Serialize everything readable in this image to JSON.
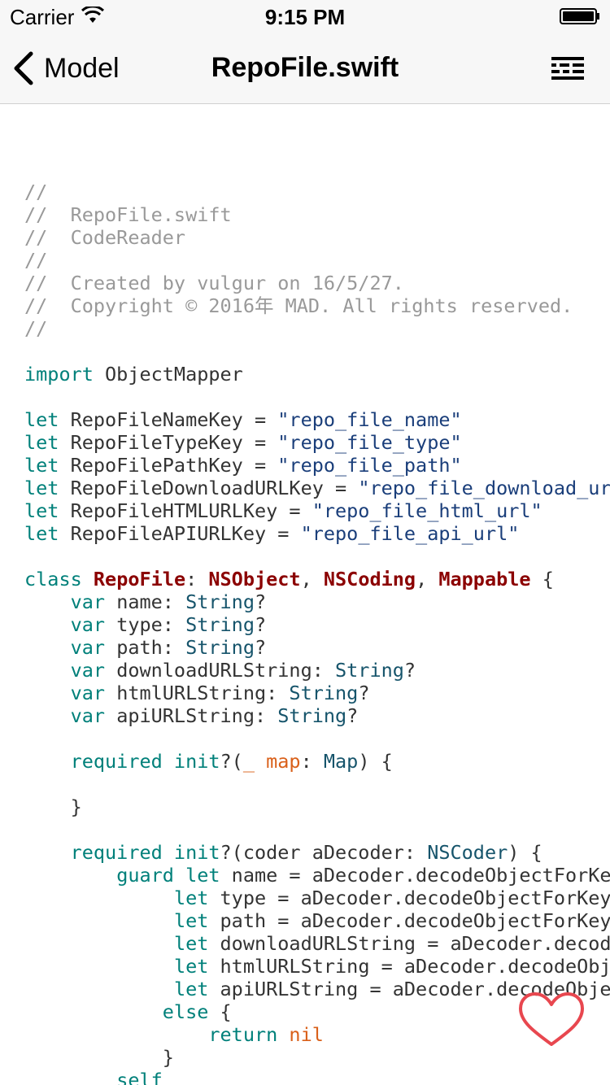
{
  "status_bar": {
    "carrier": "Carrier",
    "time": "9:15 PM"
  },
  "nav": {
    "back_label": "Model",
    "title": "RepoFile.swift"
  },
  "colors": {
    "keyword": "#00807a",
    "comment": "#999999",
    "class_name": "#8b0000",
    "string": "#1a3e7a",
    "param": "#d9601a",
    "heart": "#e8474f"
  },
  "code_lines": [
    [
      {
        "t": "//",
        "k": "comment"
      }
    ],
    [
      {
        "t": "//  RepoFile.swift",
        "k": "comment"
      }
    ],
    [
      {
        "t": "//  CodeReader",
        "k": "comment"
      }
    ],
    [
      {
        "t": "//",
        "k": "comment"
      }
    ],
    [
      {
        "t": "//  Created by vulgur on 16/5/27.",
        "k": "comment"
      }
    ],
    [
      {
        "t": "//  Copyright © 2016年 MAD. All rights reserved.",
        "k": "comment"
      }
    ],
    [
      {
        "t": "//",
        "k": "comment"
      }
    ],
    [],
    [
      {
        "t": "import",
        "k": "kw"
      },
      {
        "t": " ObjectMapper",
        "k": "plain"
      }
    ],
    [],
    [
      {
        "t": "let",
        "k": "kw"
      },
      {
        "t": " RepoFileNameKey = ",
        "k": "plain"
      },
      {
        "t": "\"repo_file_name\"",
        "k": "str"
      }
    ],
    [
      {
        "t": "let",
        "k": "kw"
      },
      {
        "t": " RepoFileTypeKey = ",
        "k": "plain"
      },
      {
        "t": "\"repo_file_type\"",
        "k": "str"
      }
    ],
    [
      {
        "t": "let",
        "k": "kw"
      },
      {
        "t": " RepoFilePathKey = ",
        "k": "plain"
      },
      {
        "t": "\"repo_file_path\"",
        "k": "str"
      }
    ],
    [
      {
        "t": "let",
        "k": "kw"
      },
      {
        "t": " RepoFileDownloadURLKey = ",
        "k": "plain"
      },
      {
        "t": "\"repo_file_download_url\"",
        "k": "str"
      }
    ],
    [
      {
        "t": "let",
        "k": "kw"
      },
      {
        "t": " RepoFileHTMLURLKey = ",
        "k": "plain"
      },
      {
        "t": "\"repo_file_html_url\"",
        "k": "str"
      }
    ],
    [
      {
        "t": "let",
        "k": "kw"
      },
      {
        "t": " RepoFileAPIURLKey = ",
        "k": "plain"
      },
      {
        "t": "\"repo_file_api_url\"",
        "k": "str"
      }
    ],
    [],
    [
      {
        "t": "class",
        "k": "kw"
      },
      {
        "t": " ",
        "k": "plain"
      },
      {
        "t": "RepoFile",
        "k": "cls"
      },
      {
        "t": ": ",
        "k": "plain"
      },
      {
        "t": "NSObject",
        "k": "cls"
      },
      {
        "t": ", ",
        "k": "plain"
      },
      {
        "t": "NSCoding",
        "k": "cls"
      },
      {
        "t": ", ",
        "k": "plain"
      },
      {
        "t": "Mappable",
        "k": "cls"
      },
      {
        "t": " {",
        "k": "plain"
      }
    ],
    [
      {
        "t": "    ",
        "k": "plain"
      },
      {
        "t": "var",
        "k": "kw"
      },
      {
        "t": " name: ",
        "k": "plain"
      },
      {
        "t": "String",
        "k": "type"
      },
      {
        "t": "?",
        "k": "plain"
      }
    ],
    [
      {
        "t": "    ",
        "k": "plain"
      },
      {
        "t": "var",
        "k": "kw"
      },
      {
        "t": " type: ",
        "k": "plain"
      },
      {
        "t": "String",
        "k": "type"
      },
      {
        "t": "?",
        "k": "plain"
      }
    ],
    [
      {
        "t": "    ",
        "k": "plain"
      },
      {
        "t": "var",
        "k": "kw"
      },
      {
        "t": " path: ",
        "k": "plain"
      },
      {
        "t": "String",
        "k": "type"
      },
      {
        "t": "?",
        "k": "plain"
      }
    ],
    [
      {
        "t": "    ",
        "k": "plain"
      },
      {
        "t": "var",
        "k": "kw"
      },
      {
        "t": " downloadURLString: ",
        "k": "plain"
      },
      {
        "t": "String",
        "k": "type"
      },
      {
        "t": "?",
        "k": "plain"
      }
    ],
    [
      {
        "t": "    ",
        "k": "plain"
      },
      {
        "t": "var",
        "k": "kw"
      },
      {
        "t": " htmlURLString: ",
        "k": "plain"
      },
      {
        "t": "String",
        "k": "type"
      },
      {
        "t": "?",
        "k": "plain"
      }
    ],
    [
      {
        "t": "    ",
        "k": "plain"
      },
      {
        "t": "var",
        "k": "kw"
      },
      {
        "t": " apiURLString: ",
        "k": "plain"
      },
      {
        "t": "String",
        "k": "type"
      },
      {
        "t": "?",
        "k": "plain"
      }
    ],
    [],
    [
      {
        "t": "    ",
        "k": "plain"
      },
      {
        "t": "required init",
        "k": "kw"
      },
      {
        "t": "?(",
        "k": "plain"
      },
      {
        "t": "_ map",
        "k": "param"
      },
      {
        "t": ": ",
        "k": "plain"
      },
      {
        "t": "Map",
        "k": "type"
      },
      {
        "t": ") {",
        "k": "plain"
      }
    ],
    [],
    [
      {
        "t": "    }",
        "k": "plain"
      }
    ],
    [],
    [
      {
        "t": "    ",
        "k": "plain"
      },
      {
        "t": "required init",
        "k": "kw"
      },
      {
        "t": "?(coder aDecoder: ",
        "k": "plain"
      },
      {
        "t": "NSCoder",
        "k": "type"
      },
      {
        "t": ") {",
        "k": "plain"
      }
    ],
    [
      {
        "t": "        ",
        "k": "plain"
      },
      {
        "t": "guard let",
        "k": "kw"
      },
      {
        "t": " name = aDecoder.decodeObjectForKey(",
        "k": "plain"
      }
    ],
    [
      {
        "t": "             ",
        "k": "plain"
      },
      {
        "t": "let",
        "k": "kw"
      },
      {
        "t": " type = aDecoder.decodeObjectForKey(",
        "k": "plain"
      }
    ],
    [
      {
        "t": "             ",
        "k": "plain"
      },
      {
        "t": "let",
        "k": "kw"
      },
      {
        "t": " path = aDecoder.decodeObjectForKey(",
        "k": "plain"
      }
    ],
    [
      {
        "t": "             ",
        "k": "plain"
      },
      {
        "t": "let",
        "k": "kw"
      },
      {
        "t": " downloadURLString = aDecoder.decodeObject",
        "k": "plain"
      }
    ],
    [
      {
        "t": "             ",
        "k": "plain"
      },
      {
        "t": "let",
        "k": "kw"
      },
      {
        "t": " htmlURLString = aDecoder.decodeObject",
        "k": "plain"
      }
    ],
    [
      {
        "t": "             ",
        "k": "plain"
      },
      {
        "t": "let",
        "k": "kw"
      },
      {
        "t": " apiURLString = aDecoder.decodeObject",
        "k": "plain"
      }
    ],
    [
      {
        "t": "            ",
        "k": "plain"
      },
      {
        "t": "else",
        "k": "kw"
      },
      {
        "t": " {",
        "k": "plain"
      }
    ],
    [
      {
        "t": "                ",
        "k": "plain"
      },
      {
        "t": "return",
        "k": "kw"
      },
      {
        "t": " ",
        "k": "plain"
      },
      {
        "t": "nil",
        "k": "param"
      }
    ],
    [
      {
        "t": "            }",
        "k": "plain"
      }
    ],
    [
      {
        "t": "        ",
        "k": "plain"
      },
      {
        "t": "self",
        "k": "kw"
      }
    ]
  ]
}
